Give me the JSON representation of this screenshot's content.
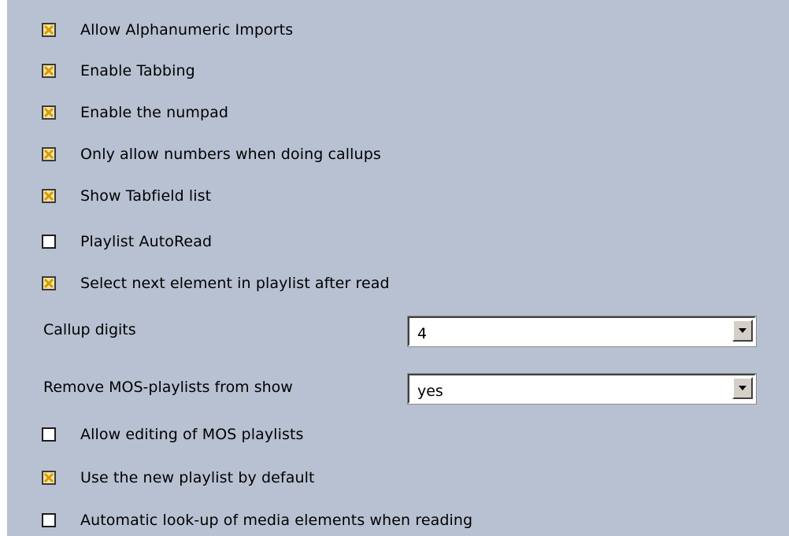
{
  "settings": {
    "allow_alphanumeric_imports": {
      "label": "Allow Alphanumeric Imports",
      "checked": true
    },
    "enable_tabbing": {
      "label": "Enable Tabbing",
      "checked": true
    },
    "enable_numpad": {
      "label": "Enable the numpad",
      "checked": true
    },
    "only_numbers_callups": {
      "label": "Only allow numbers when doing callups",
      "checked": true
    },
    "show_tabfield_list": {
      "label": "Show Tabfield list",
      "checked": true
    },
    "playlist_autoread": {
      "label": "Playlist AutoRead",
      "checked": false
    },
    "select_next_element": {
      "label": "Select next element in playlist after read",
      "checked": true
    },
    "callup_digits": {
      "label": "Callup digits",
      "value": "4"
    },
    "remove_mos_playlists": {
      "label": "Remove MOS-playlists from show",
      "value": "yes"
    },
    "allow_editing_mos": {
      "label": "Allow editing of MOS playlists",
      "checked": false
    },
    "use_new_playlist": {
      "label": "Use the new playlist by default",
      "checked": true
    },
    "automatic_lookup_media": {
      "label": "Automatic look-up of media elements when reading",
      "checked": false
    }
  },
  "icons": {
    "check_mark": "x-check-icon",
    "dropdown_arrow": "chevron-down-icon"
  },
  "colors": {
    "panel_background": "#b8c1d2",
    "checked_fill": "#f4e4a8",
    "check_mark": "#d89b00"
  }
}
